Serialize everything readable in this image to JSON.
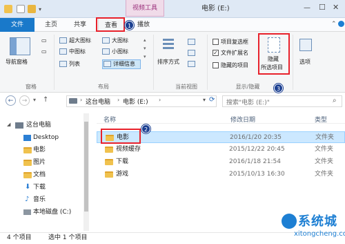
{
  "window": {
    "title": "电影 (E:)",
    "context_tab": "视频工具"
  },
  "ribbon_tabs": {
    "file": "文件",
    "home": "主页",
    "share": "共享",
    "view": "查看",
    "play": "播放"
  },
  "ribbon": {
    "nav_pane": "导航窗格",
    "group_pane": "窗格",
    "layout": {
      "xl_icons": "超大图标",
      "l_icons": "大图标",
      "m_icons": "中图标",
      "s_icons": "小图标",
      "list": "列表",
      "details": "详细信息"
    },
    "group_layout": "布局",
    "sort_by": "排序方式",
    "group_current_view": "当前视图",
    "checkboxes": {
      "item_check": "项目复选框",
      "file_ext": "文件扩展名",
      "hidden_items": "隐藏的项目"
    },
    "file_ext_checked": true,
    "hide_selected_line1": "隐藏",
    "hide_selected_line2": "所选项目",
    "options": "选项",
    "group_show_hide": "显示/隐藏"
  },
  "annotations": {
    "step1": "1",
    "step2": "2",
    "step3": "3"
  },
  "address": {
    "path_this_pc": "这台电脑",
    "path_drive": "电影 (E:)",
    "search_placeholder": "搜索\"电影 (E:)\""
  },
  "nav_pane": {
    "items": [
      "这台电脑",
      "Desktop",
      "电影",
      "图片",
      "文档",
      "下载",
      "音乐",
      "本地磁盘 (C:)"
    ]
  },
  "file_list": {
    "col_name": "名称",
    "col_modified": "修改日期",
    "col_type": "类型",
    "rows": [
      {
        "name": "电影",
        "modified": "2016/1/20 20:35",
        "type": "文件夹"
      },
      {
        "name": "视频缓存",
        "modified": "2015/12/22 20:45",
        "type": "文件夹"
      },
      {
        "name": "下载",
        "modified": "2016/1/18 21:54",
        "type": "文件夹"
      },
      {
        "name": "游戏",
        "modified": "2015/10/13 16:30",
        "type": "文件夹"
      }
    ]
  },
  "status": {
    "count": "4 个项目",
    "selected": "选中 1 个项目"
  },
  "watermark": {
    "brand": "系统城",
    "url": "xitongcheng.com"
  },
  "colors": {
    "accent": "#1979ca",
    "highlight_red": "#e8212b",
    "badge_blue": "#1b3f91",
    "selection": "#cce8ff",
    "folder": "#f0c24e"
  }
}
